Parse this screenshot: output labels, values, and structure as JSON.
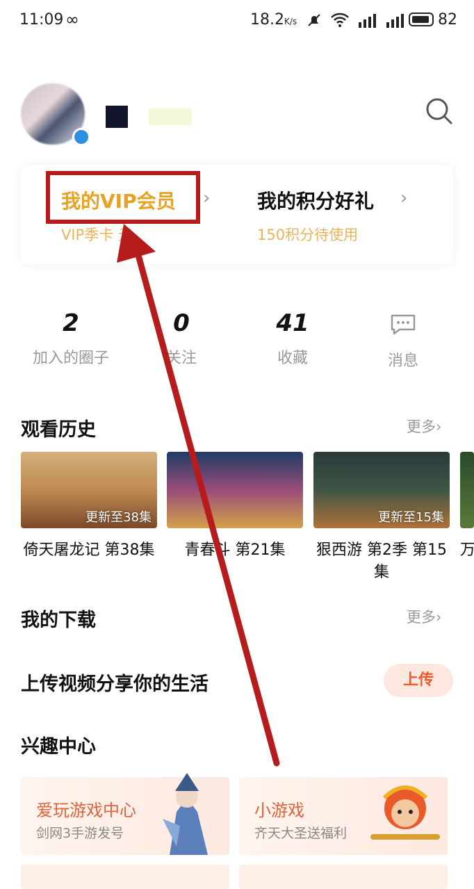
{
  "status_bar": {
    "time": "11:09",
    "loop_icon": "infinity-icon",
    "speed": "18.2",
    "speed_unit": "K/s",
    "battery": "82"
  },
  "vip_card": {
    "vip_title": "我的VIP会员",
    "vip_sub": "VIP季卡 元",
    "points_title": "我的积分好礼",
    "points_sub": "150积分待使用",
    "arrow": "›"
  },
  "stats": [
    {
      "value": "2",
      "label": "加入的圈子"
    },
    {
      "value": "0",
      "label": "关注"
    },
    {
      "value": "41",
      "label": "收藏"
    },
    {
      "label": "消息"
    }
  ],
  "history": {
    "title": "观看历史",
    "more": "更多›",
    "items": [
      {
        "badge": "更新至38集",
        "caption": "倚天屠龙记 第38集"
      },
      {
        "badge": "",
        "caption": "青春斗 第21集"
      },
      {
        "badge": "更新至15集",
        "caption": "狠西游 第2季 第15集"
      },
      {
        "badge": "",
        "caption": "万"
      }
    ]
  },
  "downloads": {
    "title": "我的下载",
    "more": "更多›"
  },
  "upload": {
    "title": "上传视频分享你的生活",
    "button": "上传"
  },
  "interest": {
    "title": "兴趣中心",
    "cards": [
      {
        "title": "爱玩游戏中心",
        "sub": "剑网3手游发号"
      },
      {
        "title": "小游戏",
        "sub": "齐天大圣送福利"
      }
    ]
  },
  "colors": {
    "vip_gold": "#e5a223",
    "annotation_red": "#b71c1c",
    "accent_orange": "#f05a2a"
  }
}
